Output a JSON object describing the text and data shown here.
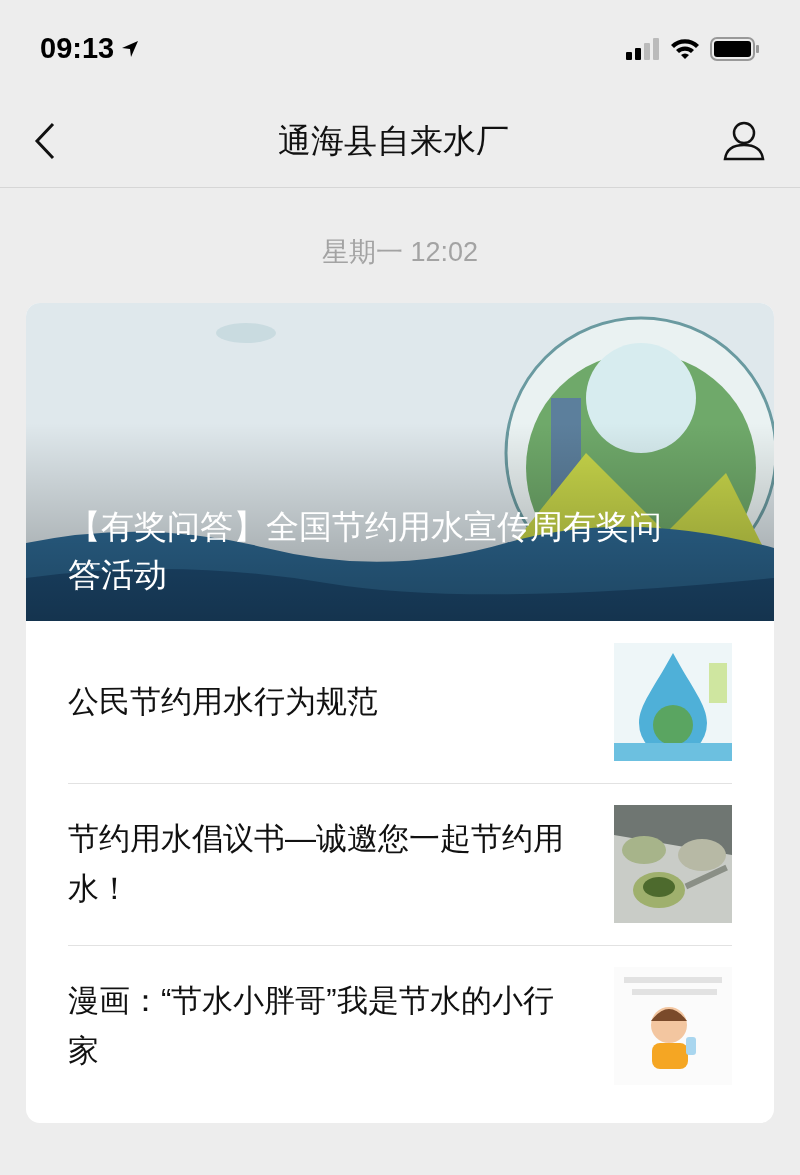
{
  "status_bar": {
    "time": "09:13"
  },
  "nav": {
    "title": "通海县自来水厂"
  },
  "timestamp": "星期一 12:02",
  "card": {
    "cover": {
      "title": "【有奖问答】全国节约用水宣传周有奖问答活动"
    },
    "articles": [
      {
        "title": "公民节约用水行为规范"
      },
      {
        "title": "节约用水倡议书—诚邀您一起节约用水！"
      },
      {
        "title": "漫画：“节水小胖哥”我是节水的小行家"
      }
    ]
  }
}
